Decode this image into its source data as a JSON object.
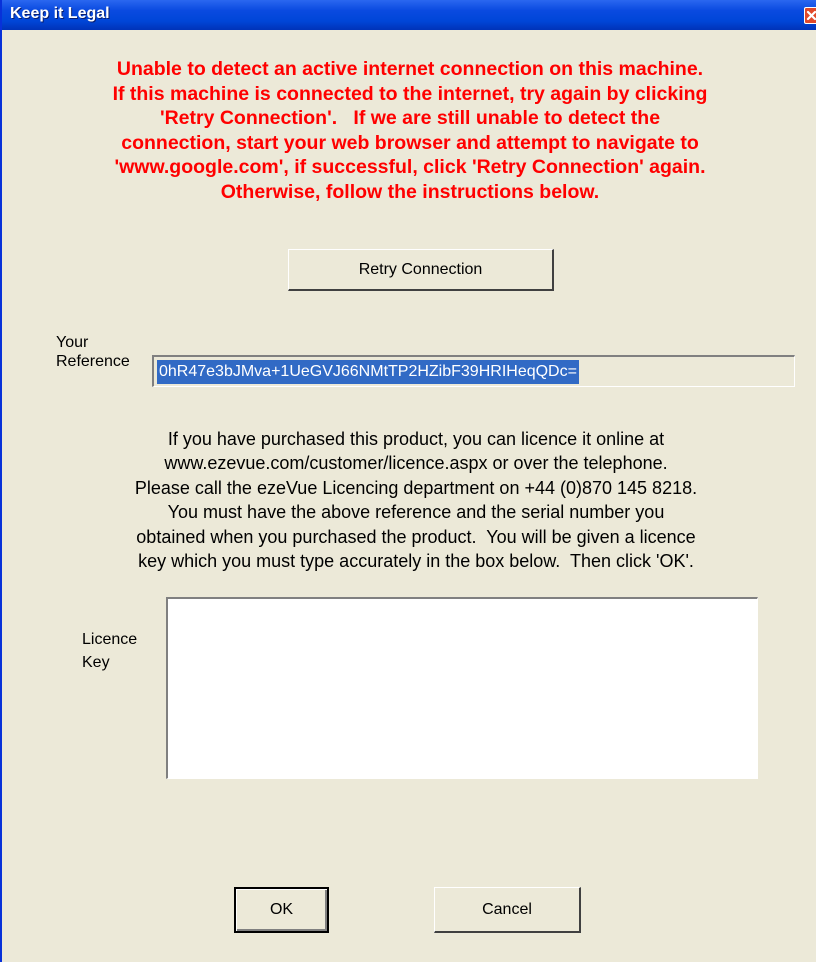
{
  "window": {
    "title": "Keep it Legal"
  },
  "warning_lines": [
    "Unable to detect an active internet connection on this machine.",
    "If this machine is connected to the internet, try again by clicking",
    "'Retry Connection'.   If we are still unable to detect the",
    "connection, start your web browser and attempt to navigate to",
    "'www.google.com', if successful, click 'Retry Connection' again.",
    "Otherwise, follow the instructions below."
  ],
  "buttons": {
    "retry": "Retry Connection",
    "ok": "OK",
    "cancel": "Cancel"
  },
  "reference": {
    "label_line1": "Your",
    "label_line2": "Reference",
    "value": "0hR47e3bJMva+1UeGVJ66NMtTP2HZibF39HRIHeqQDc="
  },
  "info_lines": [
    "If you have purchased this product, you can licence it online at",
    "www.ezevue.com/customer/licence.aspx or over the telephone.",
    "Please call the ezeVue Licencing department on +44 (0)870 145 8218.",
    "You must have the above reference and the serial number you",
    "obtained when you purchased the product.  You will be given a licence",
    "key which you must type accurately in the box below.  Then click 'OK'."
  ],
  "licence": {
    "label_line1": "Licence",
    "label_line2": "Key",
    "value": ""
  },
  "colors": {
    "title_bar": "#0046d8",
    "warning_text": "#ff0000",
    "selection": "#316ac5",
    "dialog_bg": "#ece9d8"
  }
}
